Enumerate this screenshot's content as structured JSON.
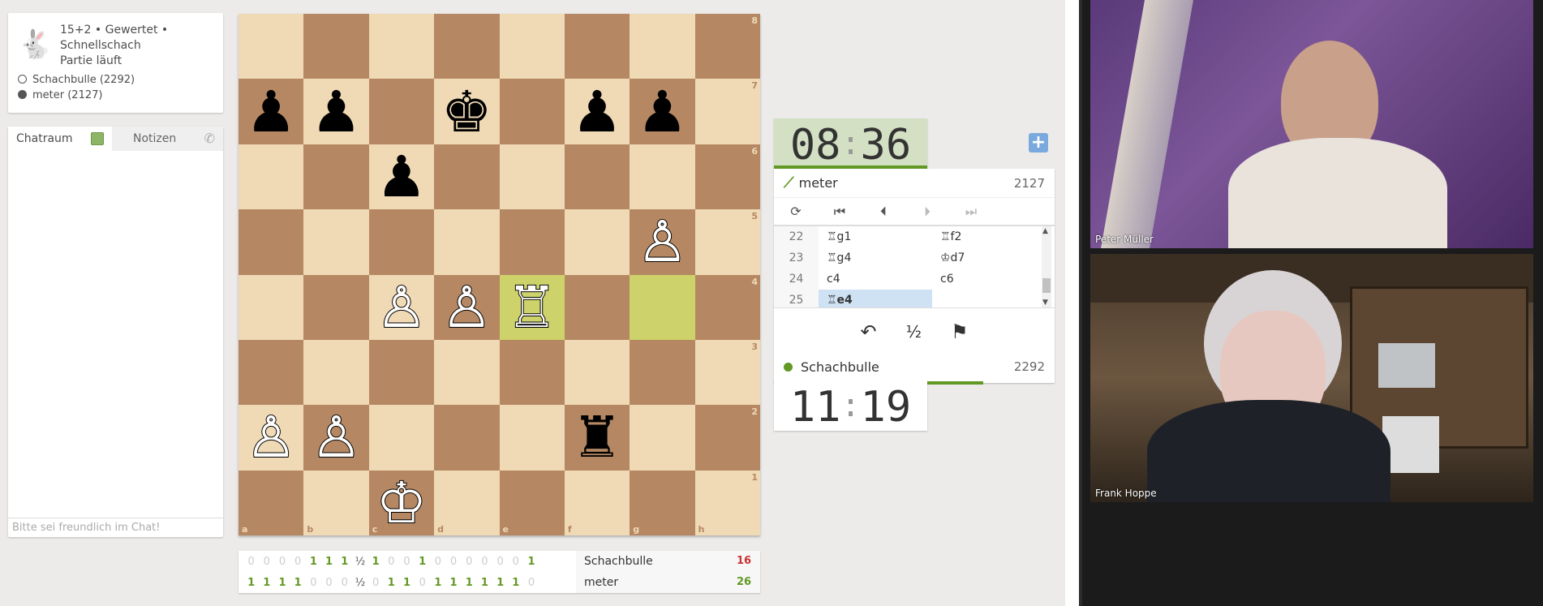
{
  "game": {
    "icon": "rabbit-icon",
    "line1": "15+2 • Gewertet •",
    "line2": "Schnellschach",
    "line3": "Partie läuft",
    "white_player": "Schachbulle (2292)",
    "black_player": "meter (2127)"
  },
  "chat": {
    "tab_chat": "Chatraum",
    "tab_notes": "Notizen",
    "placeholder": "Bitte sei freundlich im Chat!"
  },
  "board": {
    "ranks": [
      "8",
      "7",
      "6",
      "5",
      "4",
      "3",
      "2",
      "1"
    ],
    "files": [
      "a",
      "b",
      "c",
      "d",
      "e",
      "f",
      "g",
      "h"
    ],
    "position": [
      [
        "",
        "",
        "",
        "",
        "",
        "",
        "",
        ""
      ],
      [
        "♟",
        "♟",
        "",
        "♚",
        "",
        "♟",
        "♟",
        ""
      ],
      [
        "",
        "",
        "♟",
        "",
        "",
        "",
        "",
        ""
      ],
      [
        "",
        "",
        "",
        "",
        "",
        "",
        "♙",
        ""
      ],
      [
        "",
        "",
        "♙",
        "♙",
        "♖",
        "",
        "",
        ""
      ],
      [
        "",
        "",
        "",
        "",
        "",
        "",
        "",
        ""
      ],
      [
        "♙",
        "♙",
        "",
        "",
        "",
        "♜",
        "",
        ""
      ],
      [
        "",
        "",
        "♔",
        "",
        "",
        "",
        "",
        ""
      ]
    ],
    "white_pieces": [
      "♙",
      "♖",
      "♔"
    ],
    "highlight": [
      "e4",
      "g4"
    ]
  },
  "crosstable": {
    "rows": [
      {
        "results": [
          "0",
          "0",
          "0",
          "0",
          "1",
          "1",
          "1",
          "½",
          "1",
          "0",
          "0",
          "1",
          "0",
          "0",
          "0",
          "0",
          "0",
          "0",
          "1"
        ],
        "name": "Schachbulle",
        "score": "16"
      },
      {
        "results": [
          "1",
          "1",
          "1",
          "1",
          "0",
          "0",
          "0",
          "½",
          "0",
          "1",
          "1",
          "0",
          "1",
          "1",
          "1",
          "1",
          "1",
          "1",
          "0"
        ],
        "name": "meter",
        "score": "26"
      }
    ]
  },
  "clocks": {
    "top": {
      "min": "08",
      "sec": "36"
    },
    "bottom": {
      "min": "11",
      "sec": "19"
    }
  },
  "top_player": {
    "name": "meter",
    "rating": "2127",
    "icon": "wing-icon"
  },
  "bottom_player": {
    "name": "Schachbulle",
    "rating": "2292",
    "status_color": "#629924"
  },
  "controls": {
    "flip": "⟳",
    "first": "⏮",
    "prev": "⏴",
    "next": "⏵",
    "last": "⏭"
  },
  "moves": [
    {
      "n": "22",
      "w": "♖g1",
      "b": "♖f2"
    },
    {
      "n": "23",
      "w": "♖g4",
      "b": "♔d7"
    },
    {
      "n": "24",
      "w": "c4",
      "b": "c6"
    },
    {
      "n": "25",
      "w": "♖e4",
      "b": ""
    }
  ],
  "actions": {
    "takeback": "↶",
    "draw": "½",
    "resign": "⚑"
  },
  "video": {
    "top_name": "Peter Müller",
    "bottom_name": "Frank Hoppe"
  },
  "colors": {
    "accent_green": "#629924",
    "board_light": "#f0d9b5",
    "board_dark": "#b58863",
    "highlight": "#cdd26a",
    "loss_red": "#cc3333"
  }
}
